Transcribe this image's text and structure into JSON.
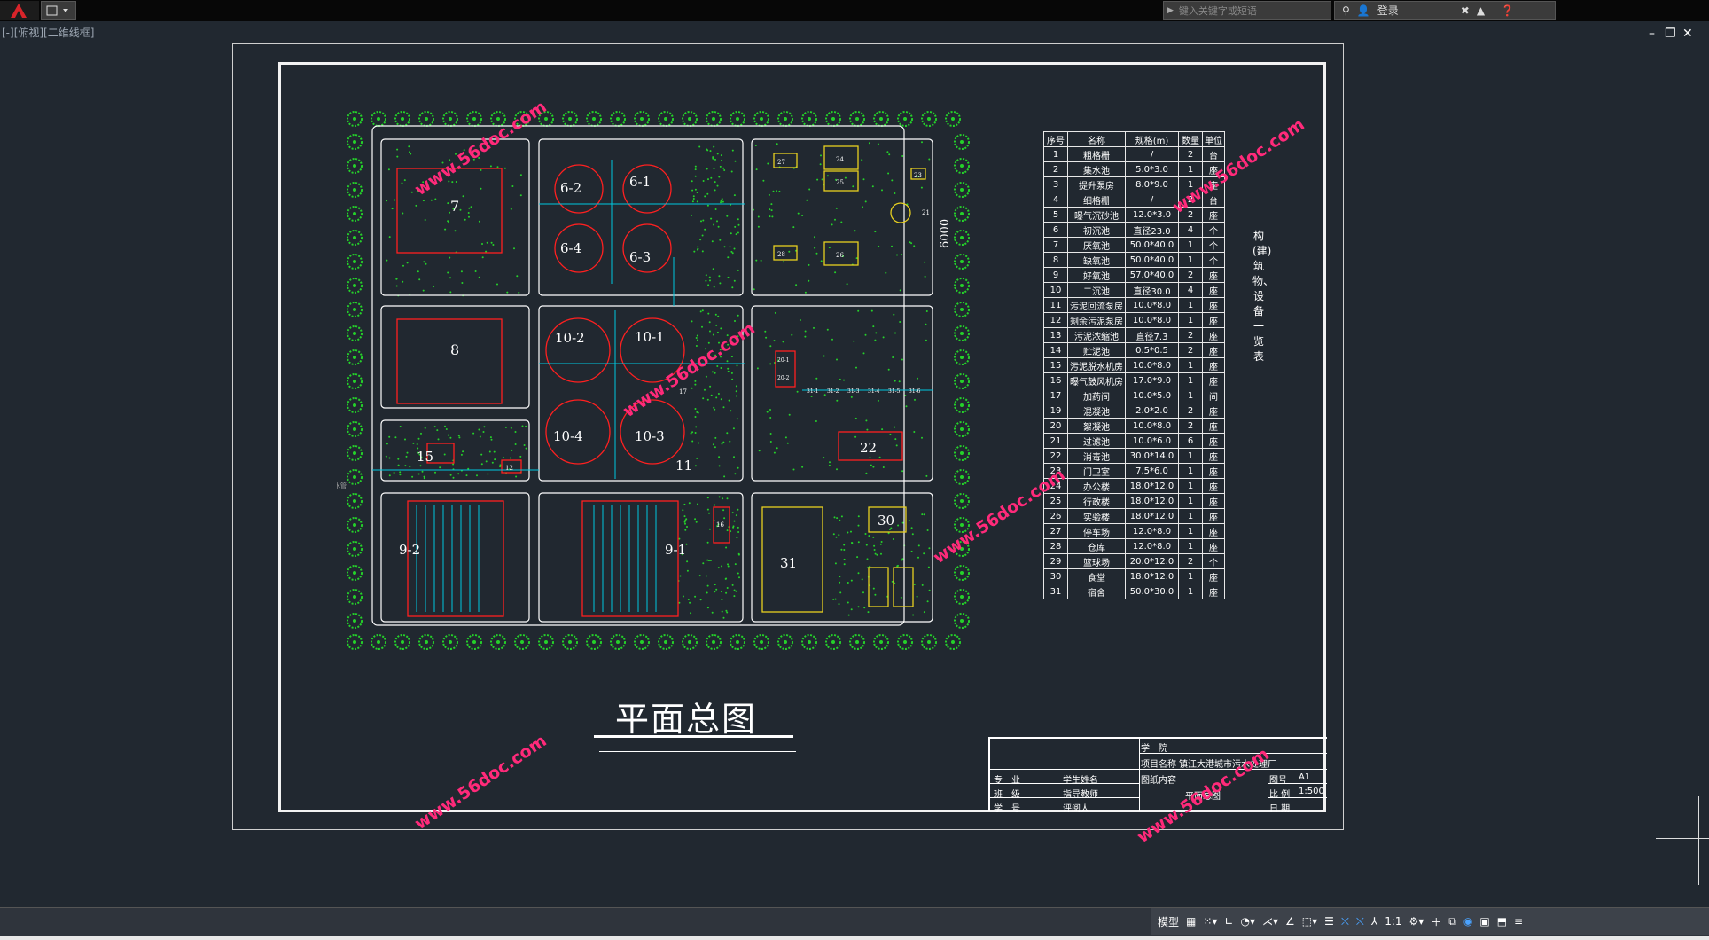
{
  "titlebar": {
    "search_placeholder": "键入关键字或短语",
    "login_label": "登录"
  },
  "view_label": "[-][俯视][二维线框]",
  "drawing": {
    "main_title": "平面总图",
    "pipe_label": "污水管",
    "width_dim": "6000",
    "buildings": [
      "7",
      "6-2",
      "6-1",
      "6-4",
      "6-3",
      "8",
      "10-2",
      "10-1",
      "10-4",
      "10-3",
      "15",
      "11",
      "9-2",
      "9-1",
      "22",
      "31",
      "30",
      "12",
      "16",
      "17",
      "21",
      "23",
      "24",
      "25",
      "26",
      "27",
      "28",
      "20-1",
      "20-2",
      "31-1",
      "31-2",
      "31-3",
      "31-4",
      "31-5",
      "31-6"
    ]
  },
  "equipment_table": {
    "headers": [
      "序号",
      "名称",
      "规格(m)",
      "数量",
      "单位"
    ],
    "rows": [
      [
        "1",
        "粗格栅",
        "/",
        "2",
        "台"
      ],
      [
        "2",
        "集水池",
        "5.0*3.0",
        "1",
        "座"
      ],
      [
        "3",
        "提升泵房",
        "8.0*9.0",
        "1",
        "座"
      ],
      [
        "4",
        "细格栅",
        "/",
        "2",
        "台"
      ],
      [
        "5",
        "曝气沉砂池",
        "12.0*3.0",
        "2",
        "座"
      ],
      [
        "6",
        "初沉池",
        "直径23.0",
        "4",
        "个"
      ],
      [
        "7",
        "厌氧池",
        "50.0*40.0",
        "1",
        "个"
      ],
      [
        "8",
        "缺氧池",
        "50.0*40.0",
        "1",
        "个"
      ],
      [
        "9",
        "好氧池",
        "57.0*40.0",
        "2",
        "座"
      ],
      [
        "10",
        "二沉池",
        "直径30.0",
        "4",
        "座"
      ],
      [
        "11",
        "污泥回流泵房",
        "10.0*8.0",
        "1",
        "座"
      ],
      [
        "12",
        "剩余污泥泵房",
        "10.0*8.0",
        "1",
        "座"
      ],
      [
        "13",
        "污泥浓缩池",
        "直径7.3",
        "2",
        "座"
      ],
      [
        "14",
        "贮泥池",
        "0.5*0.5",
        "2",
        "座"
      ],
      [
        "15",
        "污泥脱水机房",
        "10.0*8.0",
        "1",
        "座"
      ],
      [
        "16",
        "曝气鼓风机房",
        "17.0*9.0",
        "1",
        "座"
      ],
      [
        "17",
        "加药间",
        "10.0*5.0",
        "1",
        "间"
      ],
      [
        "19",
        "混凝池",
        "2.0*2.0",
        "2",
        "座"
      ],
      [
        "20",
        "絮凝池",
        "10.0*8.0",
        "2",
        "座"
      ],
      [
        "21",
        "过滤池",
        "10.0*6.0",
        "6",
        "座"
      ],
      [
        "22",
        "消毒池",
        "30.0*14.0",
        "1",
        "座"
      ],
      [
        "23",
        "门卫室",
        "7.5*6.0",
        "1",
        "座"
      ],
      [
        "24",
        "办公楼",
        "18.0*12.0",
        "1",
        "座"
      ],
      [
        "25",
        "行政楼",
        "18.0*12.0",
        "1",
        "座"
      ],
      [
        "26",
        "实验楼",
        "18.0*12.0",
        "1",
        "座"
      ],
      [
        "27",
        "停车场",
        "12.0*8.0",
        "1",
        "座"
      ],
      [
        "28",
        "仓库",
        "12.0*8.0",
        "1",
        "座"
      ],
      [
        "29",
        "篮球场",
        "20.0*12.0",
        "2",
        "个"
      ],
      [
        "30",
        "食堂",
        "18.0*12.0",
        "1",
        "座"
      ],
      [
        "31",
        "宿舍",
        "50.0*30.0",
        "1",
        "座"
      ]
    ],
    "side_title": "构(建)筑物、设备一览表"
  },
  "title_block": {
    "school": "学　院",
    "project_label": "项目名称",
    "project_value": "镇江大港城市污水处理厂",
    "major": "专　业",
    "student": "学生姓名",
    "drawing_content": "图纸内容",
    "drawing_value": "平面总图",
    "class": "班　级",
    "advisor": "指导教师",
    "id": "学　号",
    "reviewer": "评阅人",
    "sheet_label": "图号",
    "sheet_value": "A1",
    "scale_label": "比 例",
    "scale_value": "1:500",
    "date_label": "日 期"
  },
  "watermarks": [
    "www.56doc.com",
    "www.56doc.com",
    "www.56doc.com",
    "www.56doc.com",
    "www.56doc.com",
    "www.56doc.com"
  ],
  "statusbar": {
    "model_label": "模型",
    "scale": "1:1"
  },
  "colors": {
    "background": "#212830",
    "tree": "#25d12a",
    "tank": "#ff2020",
    "label": "#ff2ad5",
    "pipe": "#00c8e0",
    "building": "#e8d020",
    "watermark": "#ff2a7a"
  }
}
